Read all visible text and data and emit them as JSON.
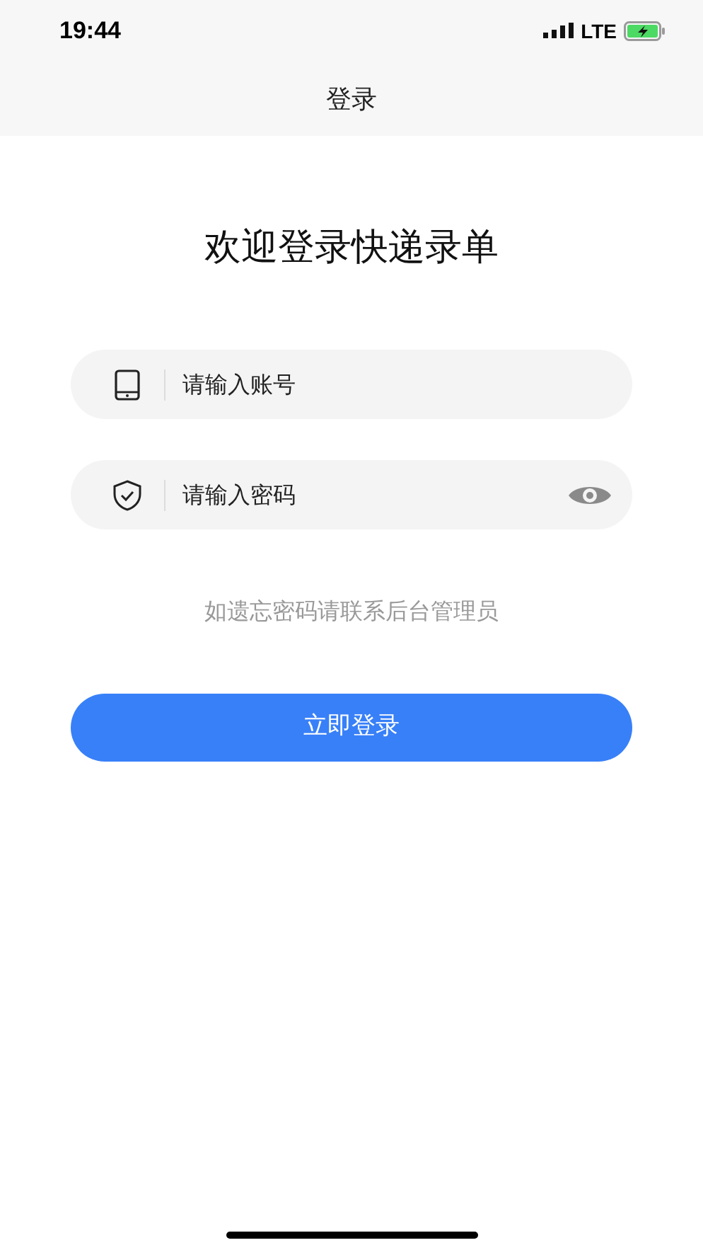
{
  "status_bar": {
    "time": "19:44",
    "network": "LTE"
  },
  "nav_bar": {
    "title": "登录"
  },
  "heading": "欢迎登录快递录单",
  "fields": [
    {
      "kind": "account",
      "placeholder": "请输入账号"
    },
    {
      "kind": "password",
      "placeholder": "请输入密码"
    }
  ],
  "hint": "如遗忘密码请联系后台管理员",
  "submit_button": "立即登录"
}
